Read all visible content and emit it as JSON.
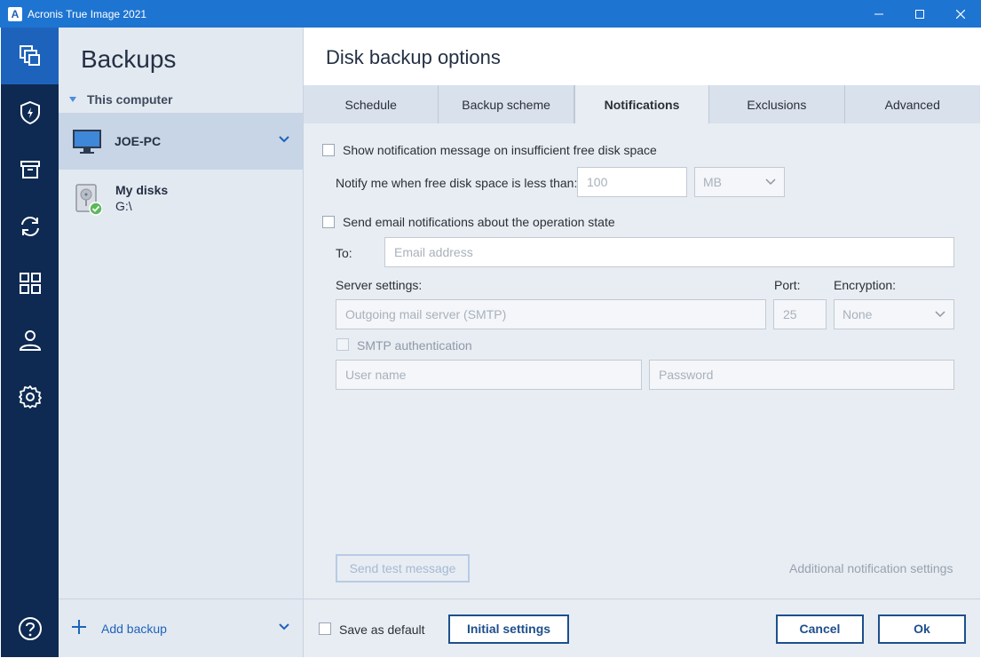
{
  "window": {
    "title": "Acronis True Image 2021",
    "logo_letter": "A"
  },
  "rail": {
    "items": [
      {
        "icon": "backup-icon",
        "active": true
      },
      {
        "icon": "protection-shield-icon",
        "active": false
      },
      {
        "icon": "archive-icon",
        "active": false
      },
      {
        "icon": "sync-icon",
        "active": false
      },
      {
        "icon": "tools-grid-icon",
        "active": false
      },
      {
        "icon": "account-icon",
        "active": false
      },
      {
        "icon": "settings-gear-icon",
        "active": false
      }
    ],
    "help_icon": "help-icon"
  },
  "backups_panel": {
    "title": "Backups",
    "group_label": "This computer",
    "selected_item": "JOE-PC",
    "disk_item": {
      "name": "My disks",
      "path": "G:\\"
    },
    "add_backup_label": "Add backup"
  },
  "main": {
    "title": "Disk backup options",
    "tabs": [
      {
        "label": "Schedule",
        "active": false
      },
      {
        "label": "Backup scheme",
        "active": false
      },
      {
        "label": "Notifications",
        "active": true
      },
      {
        "label": "Exclusions",
        "active": false
      },
      {
        "label": "Advanced",
        "active": false
      }
    ],
    "notifications": {
      "disk_space_checkbox_label": "Show notification message on insufficient free disk space",
      "notify_label": "Notify me when free disk space is less than:",
      "threshold_value": "100",
      "threshold_unit": "MB",
      "email_checkbox_label": "Send email notifications about the operation state",
      "to_label": "To:",
      "email_placeholder": "Email address",
      "server_settings_label": "Server settings:",
      "port_label": "Port:",
      "encryption_label": "Encryption:",
      "smtp_placeholder": "Outgoing mail server (SMTP)",
      "port_value": "25",
      "encryption_value": "None",
      "smtp_auth_label": "SMTP authentication",
      "username_placeholder": "User name",
      "password_placeholder": "Password",
      "send_test_label": "Send test message",
      "additional_settings_label": "Additional notification settings"
    },
    "footer": {
      "save_default_label": "Save as default",
      "initial_settings_label": "Initial settings",
      "cancel_label": "Cancel",
      "ok_label": "Ok"
    }
  },
  "colors": {
    "titlebar": "#1e74d1",
    "rail": "#0e2a52",
    "rail_active": "#1e63bb",
    "accent": "#1e4f8c"
  }
}
